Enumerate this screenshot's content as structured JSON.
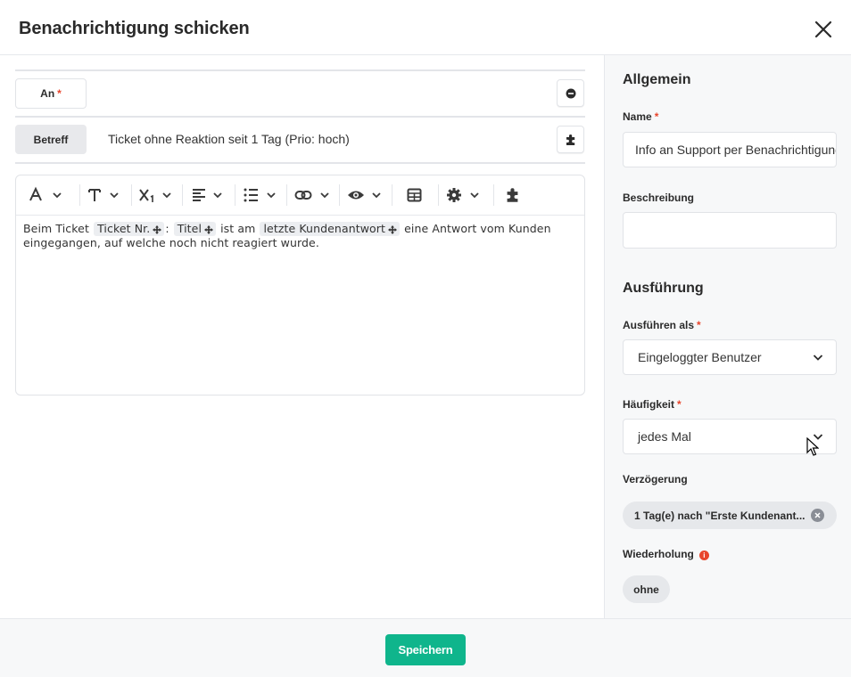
{
  "dialog": {
    "title": "Benachrichtigung schicken"
  },
  "recipient": {
    "label": "An",
    "required_mark": "*"
  },
  "subject": {
    "label": "Betreff",
    "value": "Ticket ohne Reaktion seit 1 Tag (Prio: hoch)"
  },
  "editor": {
    "toolbar": [
      "font-style-icon",
      "text-type-icon",
      "subscript-icon",
      "align-icon",
      "list-icon",
      "link-icon",
      "preview-icon",
      "table-icon",
      "settings-icon",
      "plugin-icon"
    ],
    "text_1": "Beim Ticket",
    "chip_1": "Ticket Nr.",
    "text_2": ":",
    "chip_2": "Titel",
    "text_3": "ist am",
    "chip_3": "letzte Kundenantwort",
    "text_4": "eine Antwort vom Kunden eingegangen, auf welche noch nicht reagiert wurde."
  },
  "sidebar": {
    "general_title": "Allgemein",
    "name_label": "Name",
    "name_value": "Info an Support per Benachrichtigung",
    "required_mark": "*",
    "description_label": "Beschreibung",
    "description_value": "",
    "execution_title": "Ausführung",
    "run_as_label": "Ausführen als",
    "run_as_value": "Eingeloggter Benutzer",
    "frequency_label": "Häufigkeit",
    "frequency_value": "jedes Mal",
    "delay_label": "Verzögerung",
    "delay_value": "1 Tag(e) nach \"Erste Kundenant...",
    "repeat_label": "Wiederholung",
    "repeat_info": "i",
    "repeat_value": "ohne"
  },
  "footer": {
    "save_label": "Speichern"
  },
  "colors": {
    "accent": "#0fb58c",
    "required": "#e8452c",
    "panel": "#f7f8f9"
  }
}
